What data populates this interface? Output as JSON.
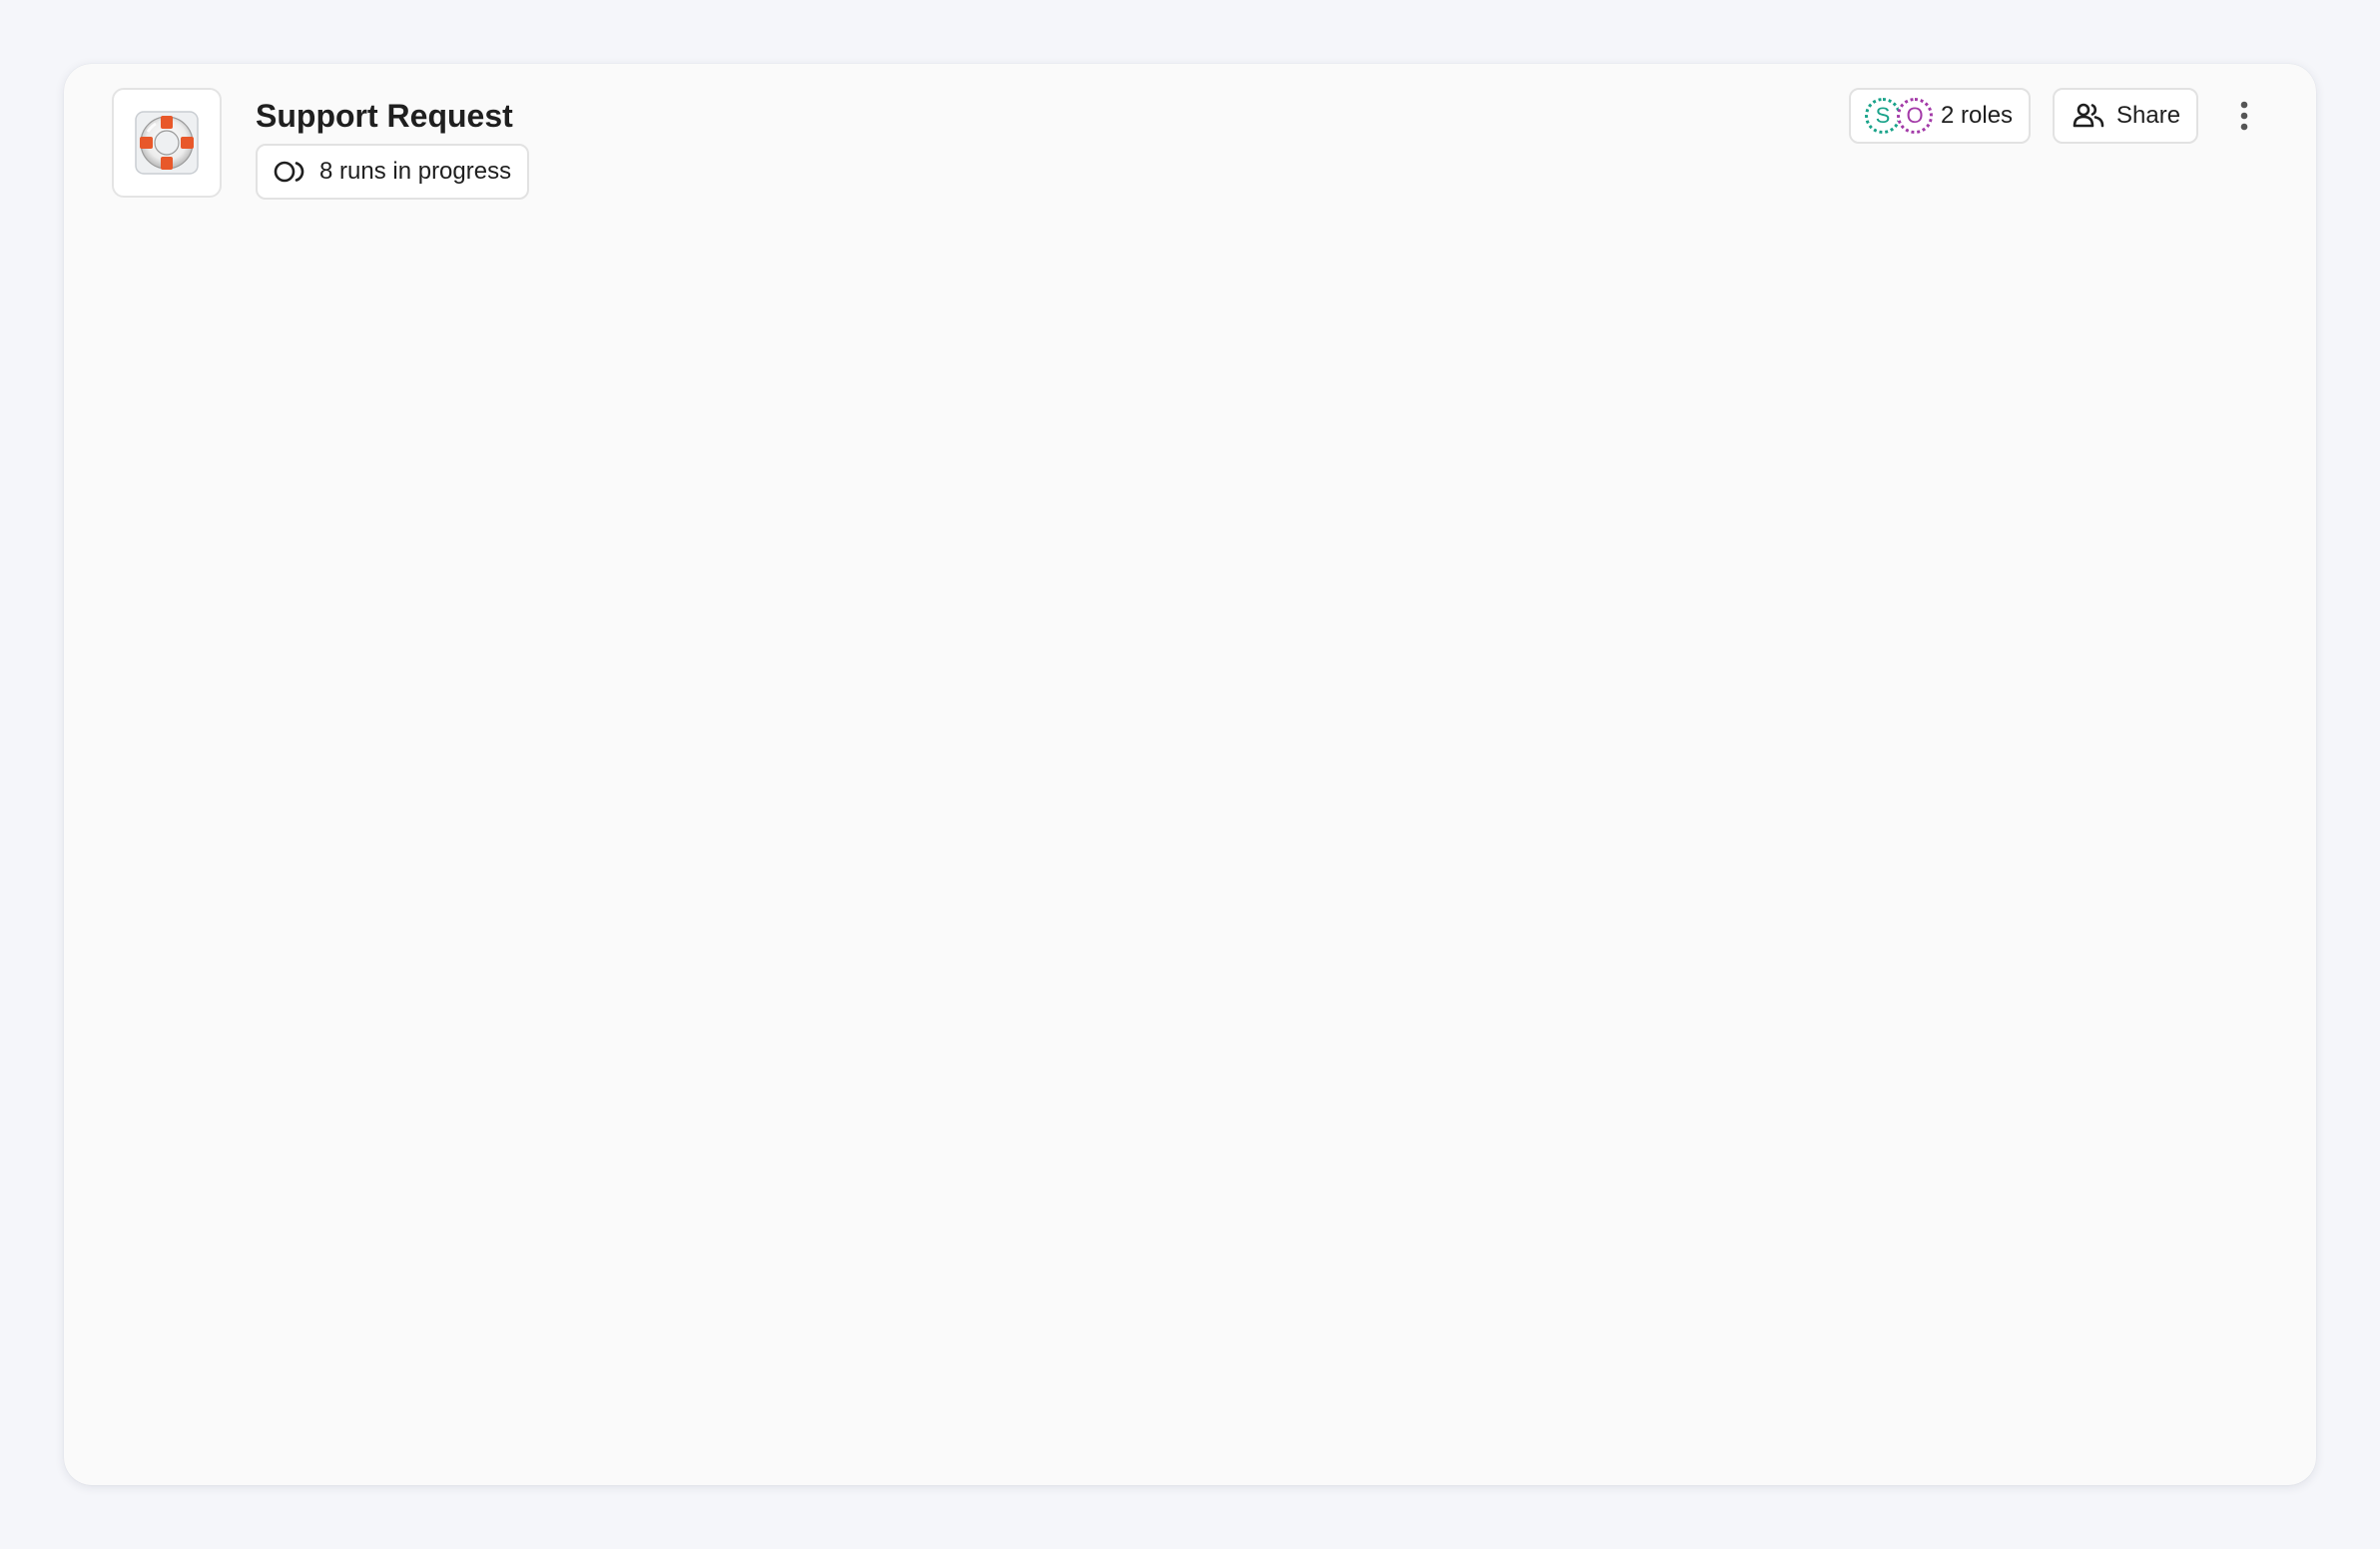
{
  "header": {
    "title": "Support Request",
    "app_icon": "lifebuoy-icon",
    "runs": {
      "icon": "runs-in-progress-icon",
      "label": "8 runs in progress"
    }
  },
  "roles": {
    "label": "2 roles",
    "avatars": [
      {
        "initial": "S",
        "color": "#1aa38a"
      },
      {
        "initial": "O",
        "color": "#a33aa8"
      }
    ]
  },
  "share": {
    "icon": "people-icon",
    "label": "Share"
  },
  "more": {
    "icon": "more-vertical-icon"
  },
  "colors": {
    "page_background": "#f5f6fa",
    "card_background": "#fafafa",
    "border": "#e2e2e2",
    "lifebuoy_orange": "#e8582a"
  }
}
